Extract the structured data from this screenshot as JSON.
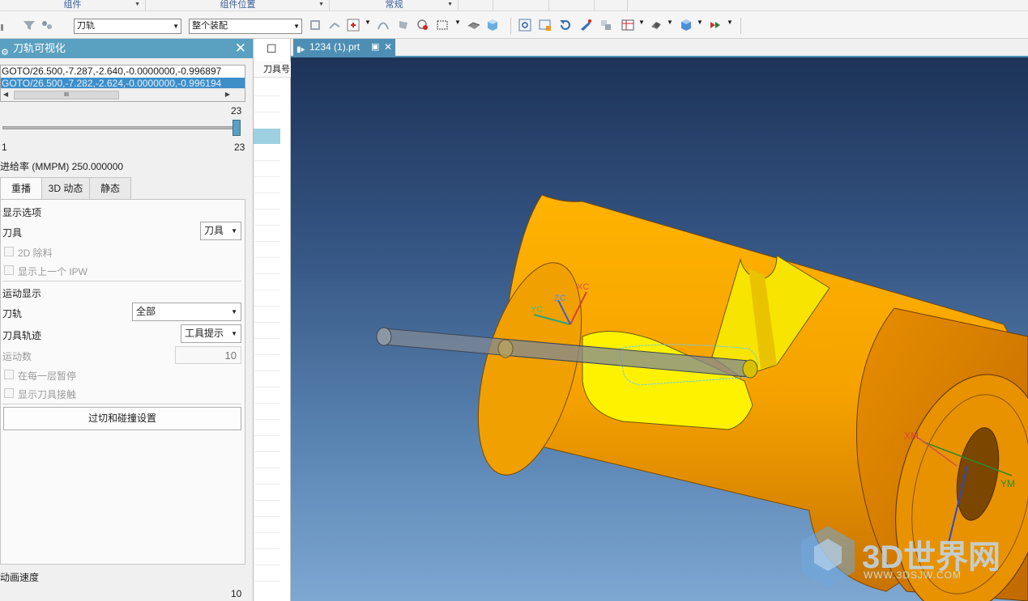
{
  "ribbon": {
    "groups": [
      "组件",
      "组件位置",
      "常规"
    ]
  },
  "toolbar": {
    "filter_value": "刀轨",
    "scope_value": "整个装配"
  },
  "panel": {
    "title": "刀轨可视化",
    "list_rows": [
      "GOTO/26.500,-7.287,-2.640,-0.0000000,-0.996897",
      "GOTO/26.500,-7.282,-2.624,-0.0000000,-0.996194"
    ],
    "scroll_thumb": "III",
    "slider": {
      "max_label": "23",
      "min_label": "1",
      "right_label": "23",
      "value": 23,
      "min": 1,
      "max": 23
    },
    "feed_rate": "进给率 (MMPM) 250.000000",
    "tabs": [
      "重播",
      "3D 动态",
      "静态"
    ],
    "display_section": "显示选项",
    "tool_label": "刀具",
    "tool_value": "刀具",
    "cb_2d_remove": "2D 除料",
    "cb_show_prev_ipw": "显示上一个 IPW",
    "motion_section": "运动显示",
    "toolpath_label": "刀轨",
    "toolpath_value": "全部",
    "tooltrace_label": "刀具轨迹",
    "tooltrace_value": "工具提示",
    "motion_count_label": "运动数",
    "motion_count_value": "10",
    "cb_pause_each_layer": "在每一层暂停",
    "cb_show_tool_contact": "显示刀具接触",
    "gouge_button": "过切和碰撞设置",
    "anim_speed_label": "动画速度",
    "anim_speed_value": "10"
  },
  "nav": {
    "header": "刀具号"
  },
  "file_tab": {
    "name": "1234 (1).prt"
  },
  "triad": {
    "xc": "XC",
    "yc": "YC",
    "zc": "ZC"
  },
  "csys": {
    "xm": "XM",
    "ym": "YM"
  },
  "watermark": {
    "main": "3D世界网",
    "url": "WWW.3DSJW.COM"
  },
  "colors": {
    "part": "#f5a500",
    "panel_title": "#5aa0c0",
    "file_tab": "#4d8fb4"
  }
}
